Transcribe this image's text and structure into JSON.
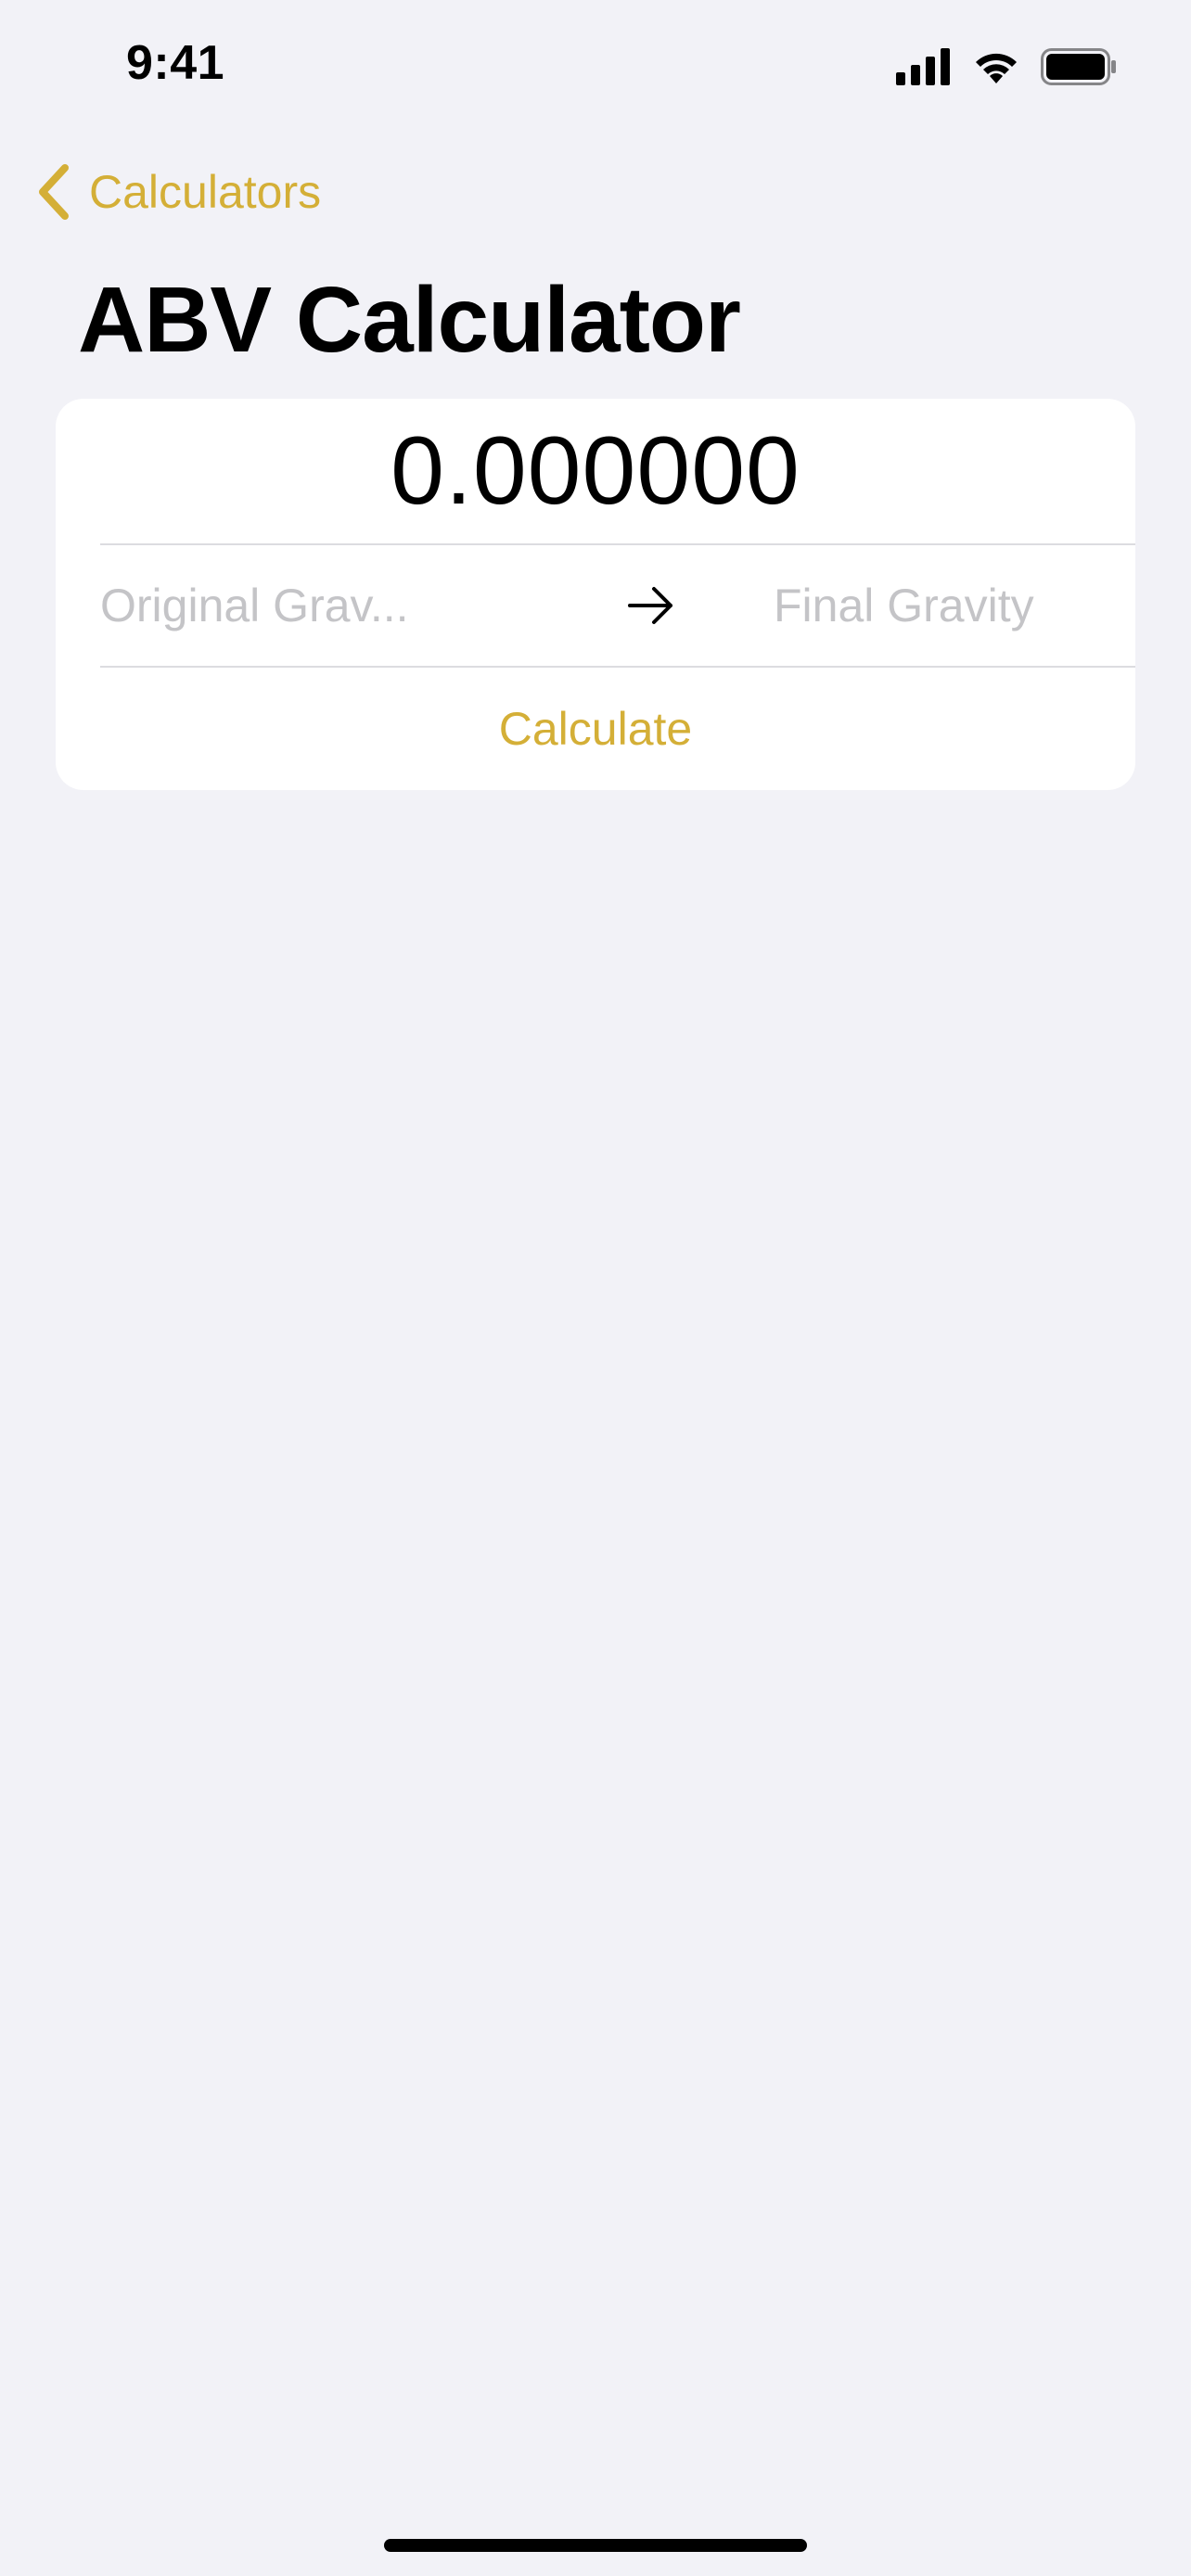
{
  "status_bar": {
    "time": "9:41"
  },
  "nav": {
    "back_label": "Calculators",
    "back_icon": "chevron-left-icon"
  },
  "page": {
    "title": "ABV Calculator"
  },
  "calculator": {
    "result": "0.000000",
    "original_gravity": {
      "value": "",
      "placeholder": "Original Grav..."
    },
    "final_gravity": {
      "value": "",
      "placeholder": "Final Gravity"
    },
    "arrow_icon": "arrow-right-icon",
    "calculate_label": "Calculate"
  },
  "colors": {
    "accent": "#D4AF37",
    "background": "#F2F2F7",
    "card": "#FFFFFF",
    "placeholder": "#C4C4C7"
  }
}
